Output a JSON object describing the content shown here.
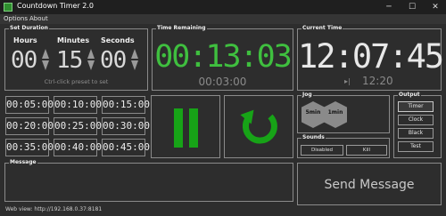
{
  "window": {
    "title": "Countdown Timer 2.0",
    "minimize_glyph": "─",
    "maximize_glyph": "☐",
    "close_glyph": "✕"
  },
  "menu": [
    "Options",
    "About"
  ],
  "set_duration": {
    "label": "Set Duration",
    "hours_label": "Hours",
    "minutes_label": "Minutes",
    "seconds_label": "Seconds",
    "hours": "00",
    "minutes": "15",
    "seconds": "00",
    "hint": "Ctrl-click preset to set"
  },
  "time_remaining": {
    "label": "Time Remaining",
    "value": "00:13:03",
    "total": "00:03:00"
  },
  "current_time": {
    "label": "Current Time",
    "value": "12:07:45",
    "secondary_icon": "skip-icon",
    "secondary_glyph": "▸|",
    "secondary_value": "12:20"
  },
  "presets": [
    "00:05:00",
    "00:10:00",
    "00:15:00",
    "00:20:00",
    "00:25:00",
    "00:30:00",
    "00:35:00",
    "00:40:00",
    "00:45:00"
  ],
  "controls": {
    "pause_icon": "pause-icon",
    "reset_icon": "restart-icon"
  },
  "jog": {
    "label": "Jog",
    "left": "5min",
    "right": "1min"
  },
  "sounds": {
    "label": "Sounds",
    "disabled": "Disabled",
    "kill": "Kill"
  },
  "output": {
    "label": "Output",
    "buttons": [
      "Timer",
      "Clock",
      "Black",
      "Test"
    ],
    "selected": "Timer"
  },
  "message": {
    "label": "Message",
    "send_label": "Send Message"
  },
  "status": {
    "web_view": "Web view: http://192.168.0.37:8181"
  },
  "colors": {
    "accent_green": "#3fbf3f",
    "button_green": "#17a317",
    "background": "#2d2d2d"
  }
}
